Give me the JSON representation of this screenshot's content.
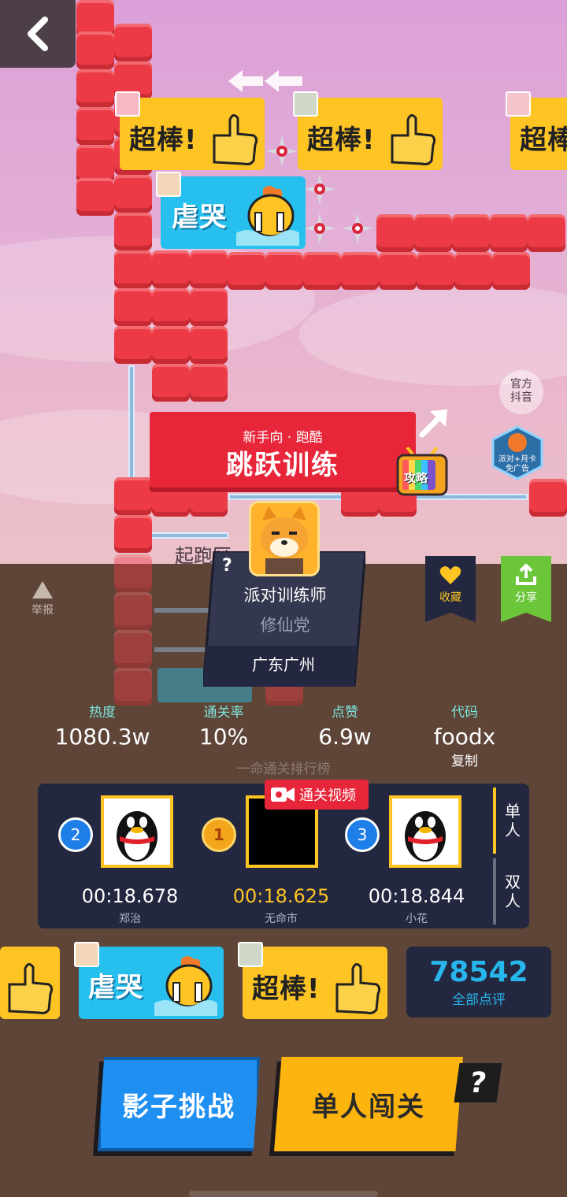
{
  "level": {
    "subtitle": "新手向 · 跑酷",
    "title": "跳跃训练",
    "start_zone": "起跑区"
  },
  "tv_label": "攻略",
  "official": "官方\n抖音",
  "party_badge": "派对+月卡\n免广告",
  "stickers": {
    "great": "超棒!",
    "cry": "虐哭"
  },
  "report_label": "举报",
  "creator": {
    "name": "派对训练师",
    "group": "修仙党",
    "location": "广东广州",
    "help_mark": "?"
  },
  "favorite_label": "收藏",
  "share_label": "分享",
  "stats": [
    {
      "label": "热度",
      "value": "1080.3w"
    },
    {
      "label": "通关率",
      "value": "10%"
    },
    {
      "label": "点赞",
      "value": "6.9w"
    },
    {
      "label": "代码",
      "value": "foodx"
    }
  ],
  "copy_label": "复制",
  "ranking": {
    "title": "一命通关排行榜",
    "video_label": "通关视频",
    "tab_single": "单\n人",
    "tab_double": "双\n人",
    "players": [
      {
        "rank": "2",
        "time": "00:18.678",
        "name": "郑治"
      },
      {
        "rank": "1",
        "time": "00:18.625",
        "name": "无命市"
      },
      {
        "rank": "3",
        "time": "00:18.844",
        "name": "小花"
      }
    ]
  },
  "reviews": {
    "count": "78542",
    "label": "全部点评"
  },
  "buttons": {
    "shadow": "影子挑战",
    "solo": "单人闯关",
    "help": "?"
  },
  "colors": {
    "accent_yellow": "#fdc424",
    "accent_blue": "#1f8ff2",
    "brick_red": "#ec3b46",
    "panel": "#5e4538"
  }
}
